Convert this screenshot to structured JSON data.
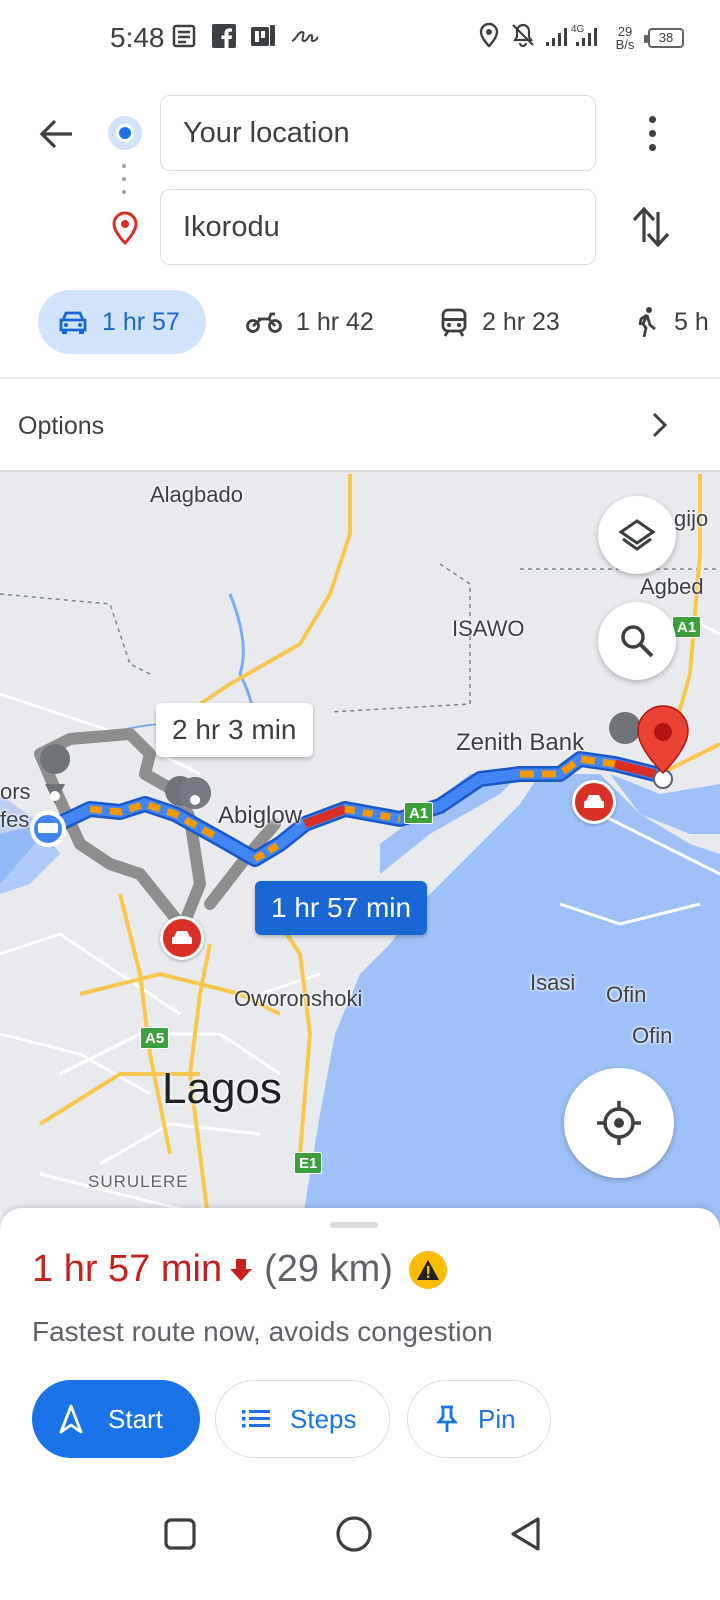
{
  "status_bar": {
    "time": "5:48",
    "net_speed_value": "29",
    "net_speed_unit": "B/s",
    "battery": "38",
    "network": "4G"
  },
  "directions": {
    "origin_value": "Your location",
    "destination_value": "Ikorodu"
  },
  "modes": [
    {
      "name": "driving",
      "duration": "1 hr 57",
      "active": true
    },
    {
      "name": "motorcycle",
      "duration": "1 hr 42"
    },
    {
      "name": "transit",
      "duration": "2 hr 23"
    },
    {
      "name": "walking",
      "duration": "5 h"
    }
  ],
  "options": {
    "label": "Options"
  },
  "map": {
    "labels": {
      "alagbado": "Alagbado",
      "isawo": "ISAWO",
      "agbed": "Agbed",
      "gijo": "gijo",
      "zenith_bank": "Zenith Bank",
      "abiglow": "Abiglow",
      "oworonshoki": "Oworonshoki",
      "isasi": "Isasi",
      "ofin1": "Ofin",
      "ofin2": "Ofin",
      "lagos": "Lagos",
      "surulere": "SURULERE",
      "ors": "ors",
      "fes": "fes"
    },
    "shields": {
      "a1a": "A1",
      "a1b": "A1",
      "a5": "A5",
      "e1": "E1"
    },
    "callouts": {
      "alt_route": "2 hr 3 min",
      "main_route": "1 hr 57 min"
    },
    "colors": {
      "route_blue": "#4285f4",
      "route_slow": "#f29900",
      "route_jam": "#d93025",
      "water": "#9ec2f7",
      "land": "#e9eaee"
    }
  },
  "sheet": {
    "duration": "1 hr 57 min",
    "distance": "(29 km)",
    "description": "Fastest route now, avoids congestion",
    "start_label": "Start",
    "steps_label": "Steps",
    "pin_label": "Pin"
  }
}
